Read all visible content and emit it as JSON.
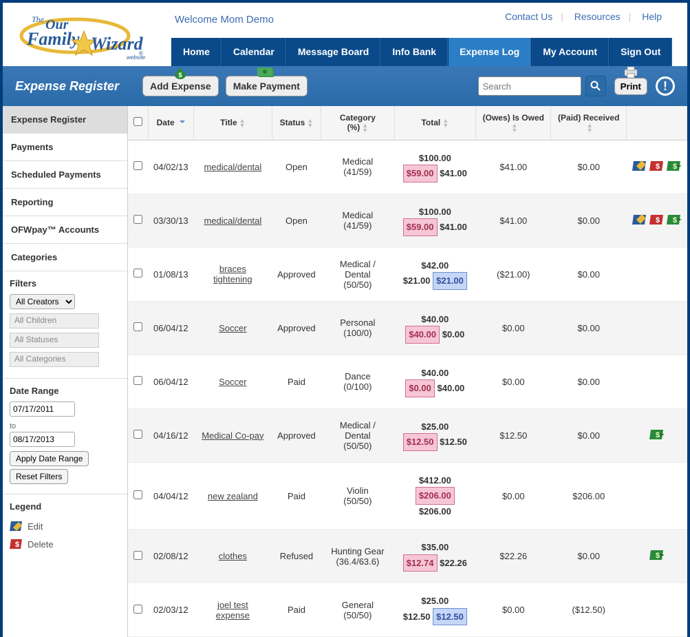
{
  "header": {
    "welcome": "Welcome Mom Demo",
    "links": {
      "contact": "Contact Us",
      "resources": "Resources",
      "help": "Help"
    },
    "nav": [
      "Home",
      "Calendar",
      "Message Board",
      "Info Bank",
      "Expense Log",
      "My Account",
      "Sign Out"
    ],
    "nav_active": 4
  },
  "toolbar": {
    "page_title": "Expense Register",
    "add_expense": "Add Expense",
    "make_payment": "Make Payment",
    "search_placeholder": "Search",
    "print": "Print"
  },
  "sidebar": {
    "items": [
      "Expense Register",
      "Payments",
      "Scheduled Payments",
      "Reporting",
      "OFWpay™ Accounts",
      "Categories"
    ],
    "active": 0,
    "filters_head": "Filters",
    "creators_label": "All Creators",
    "children_label": "All Children",
    "statuses_label": "All Statuses",
    "categories_label": "All Categories",
    "daterange_head": "Date Range",
    "date_from": "07/17/2011",
    "to": "to",
    "date_to": "08/17/2013",
    "apply": "Apply Date Range",
    "reset": "Reset Filters",
    "legend_head": "Legend",
    "legend_edit": "Edit",
    "legend_delete": "Delete"
  },
  "table": {
    "cols": [
      "",
      "Date",
      "Title",
      "Status",
      "Category (%)",
      "Total",
      "(Owes) Is Owed",
      "(Paid) Received",
      ""
    ],
    "rows": [
      {
        "date": "04/02/13",
        "title": "medical/dental",
        "status": "Open",
        "category": "Medical (41/59)",
        "total_top": "$100.00",
        "total_left": "$59.00",
        "total_left_style": "pink",
        "total_right": "$41.00",
        "owes": "$41.00",
        "paid": "$0.00",
        "icons": [
          "edit",
          "delete",
          "pay"
        ],
        "alt": false
      },
      {
        "date": "03/30/13",
        "title": "medical/dental",
        "status": "Open",
        "category": "Medical (41/59)",
        "total_top": "$100.00",
        "total_left": "$59.00",
        "total_left_style": "pink",
        "total_right": "$41.00",
        "owes": "$41.00",
        "paid": "$0.00",
        "icons": [
          "edit",
          "delete",
          "pay"
        ],
        "alt": true
      },
      {
        "date": "01/08/13",
        "title": "braces tightening",
        "status": "Approved",
        "category": "Medical / Dental (50/50)",
        "total_top": "$42.00",
        "total_left": "$21.00",
        "total_left_style": "none",
        "total_right": "$21.00",
        "total_right_style": "blue",
        "owes": "($21.00)",
        "paid": "$0.00",
        "icons": [],
        "alt": false
      },
      {
        "date": "06/04/12",
        "title": "Soccer",
        "status": "Approved",
        "category": "Personal (100/0)",
        "total_top": "$40.00",
        "total_left": "$40.00",
        "total_left_style": "pink",
        "total_right": "$0.00",
        "owes": "$0.00",
        "paid": "$0.00",
        "icons": [],
        "alt": true
      },
      {
        "date": "06/04/12",
        "title": "Soccer",
        "status": "Paid",
        "category": "Dance (0/100)",
        "total_top": "$40.00",
        "total_left": "$0.00",
        "total_left_style": "pink",
        "total_right": "$40.00",
        "owes": "$0.00",
        "paid": "$0.00",
        "icons": [],
        "alt": false
      },
      {
        "date": "04/16/12",
        "title": "Medical Co-pay",
        "status": "Approved",
        "category": "Medical / Dental (50/50)",
        "total_top": "$25.00",
        "total_left": "$12.50",
        "total_left_style": "pink",
        "total_right": "$12.50",
        "owes": "$12.50",
        "paid": "$0.00",
        "icons": [
          "pay"
        ],
        "alt": true
      },
      {
        "date": "04/04/12",
        "title": "new zealand",
        "status": "Paid",
        "category": "Violin (50/50)",
        "total_top": "$412.00",
        "total_left": "$206.00",
        "total_left_style": "pink",
        "total_right": "$206.00",
        "owes": "$0.00",
        "paid": "$206.00",
        "icons": [],
        "alt": false
      },
      {
        "date": "02/08/12",
        "title": "clothes",
        "status": "Refused",
        "category": "Hunting Gear (36.4/63.6)",
        "total_top": "$35.00",
        "total_left": "$12.74",
        "total_left_style": "pink",
        "total_right": "$22.26",
        "owes": "$22.26",
        "paid": "$0.00",
        "icons": [
          "pay"
        ],
        "alt": true
      },
      {
        "date": "02/03/12",
        "title": "joel test expense",
        "status": "Paid",
        "category": "General (50/50)",
        "total_top": "$25.00",
        "total_left": "$12.50",
        "total_left_style": "none",
        "total_right": "$12.50",
        "total_right_style": "blue",
        "owes": "$0.00",
        "paid": "($12.50)",
        "icons": [],
        "alt": false
      }
    ]
  }
}
